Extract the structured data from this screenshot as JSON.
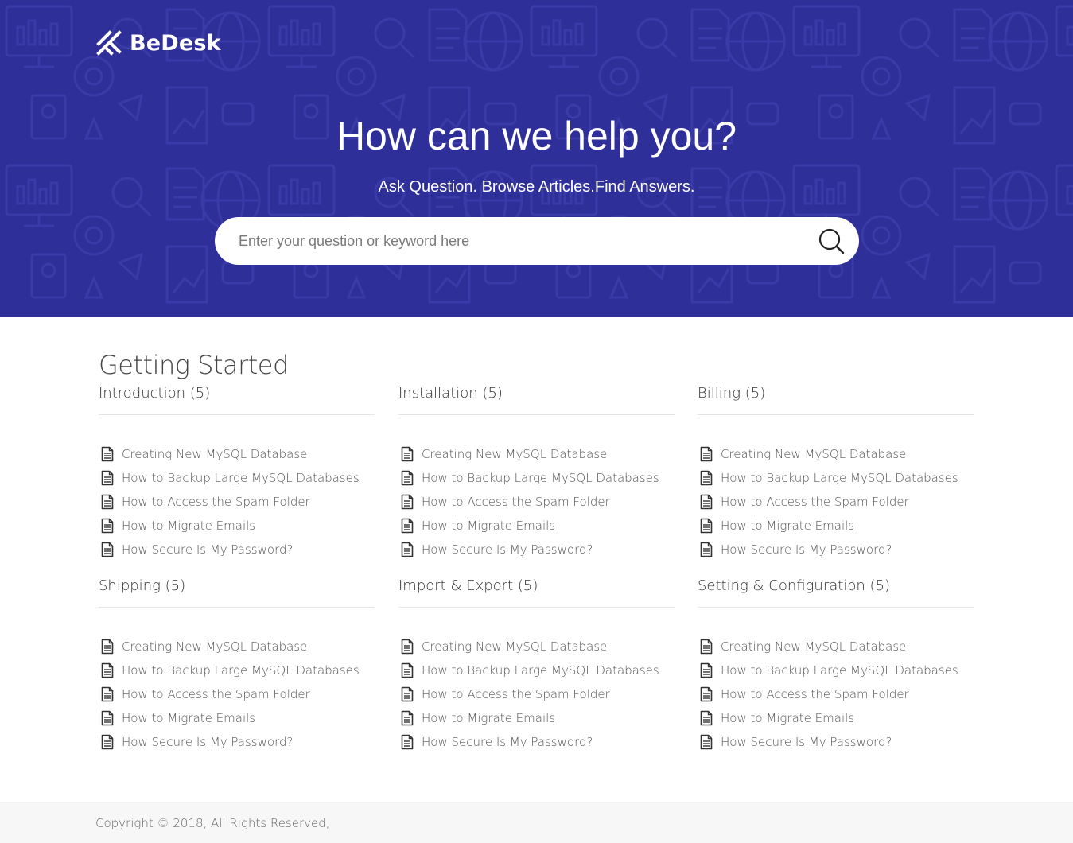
{
  "brand": {
    "name": "BeDesk"
  },
  "hero": {
    "title": "How can we help you?",
    "subtitle": "Ask Question. Browse Articles.Find Answers.",
    "search_placeholder": "Enter your question or keyword here",
    "search_icon": "search-icon",
    "background_color": "#2f2f9a"
  },
  "section": {
    "title": "Getting Started"
  },
  "categories": [
    {
      "title": "Introduction (5)",
      "articles": [
        "Creating New MySQL Database",
        "How to Backup Large MySQL Databases",
        "How to Access the Spam Folder",
        "How to Migrate Emails",
        "How Secure Is My Password?"
      ]
    },
    {
      "title": "Installation (5)",
      "articles": [
        "Creating New MySQL Database",
        "How to Backup Large MySQL Databases",
        "How to Access the Spam Folder",
        "How to Migrate Emails",
        "How Secure Is My Password?"
      ]
    },
    {
      "title": "Billing (5)",
      "articles": [
        "Creating New MySQL Database",
        "How to Backup Large MySQL Databases",
        "How to Access the Spam Folder",
        "How to Migrate Emails",
        "How Secure Is My Password?"
      ]
    },
    {
      "title": "Shipping (5)",
      "articles": [
        "Creating New MySQL Database",
        "How to Backup Large MySQL Databases",
        "How to Access the Spam Folder",
        "How to Migrate Emails",
        "How Secure Is My Password?"
      ]
    },
    {
      "title": "Import & Export (5)",
      "articles": [
        "Creating New MySQL Database",
        "How to Backup Large MySQL Databases",
        "How to Access the Spam Folder",
        "How to Migrate Emails",
        "How Secure Is My Password?"
      ]
    },
    {
      "title": "Setting & Configuration (5)",
      "articles": [
        "Creating New MySQL Database",
        "How to Backup Large MySQL Databases",
        "How to Access the Spam Folder",
        "How to Migrate Emails",
        "How Secure Is My Password?"
      ]
    }
  ],
  "footer": {
    "copyright": "Copyright © 2018, All Rights Reserved,"
  }
}
